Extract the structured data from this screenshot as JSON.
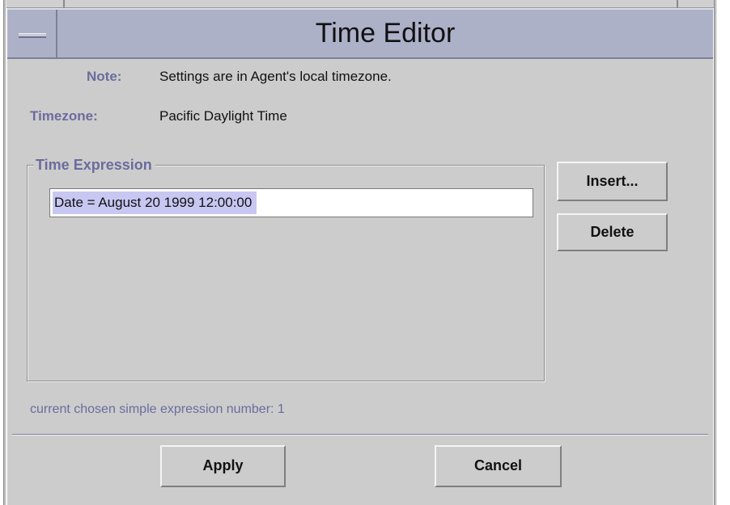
{
  "window": {
    "title": "Time Editor"
  },
  "info": {
    "note_label": "Note:",
    "note_text": "Settings are in Agent's local timezone.",
    "timezone_label": "Timezone:",
    "timezone_text": "Pacific Daylight Time"
  },
  "time_expression": {
    "group_label": "Time Expression",
    "value": "Date = August 20 1999 12:00:00"
  },
  "side_buttons": {
    "insert_label": "Insert...",
    "delete_label": "Delete"
  },
  "status": {
    "text": "current chosen simple expression number: 1"
  },
  "footer": {
    "apply_label": "Apply",
    "cancel_label": "Cancel"
  },
  "colors": {
    "title_bar": "#adb1c8",
    "dialog_bg": "#cccccc",
    "label_accent": "#6b6c9e",
    "selection": "#c7c7f2"
  },
  "icons": {
    "window_menu": "window-menu-icon"
  }
}
